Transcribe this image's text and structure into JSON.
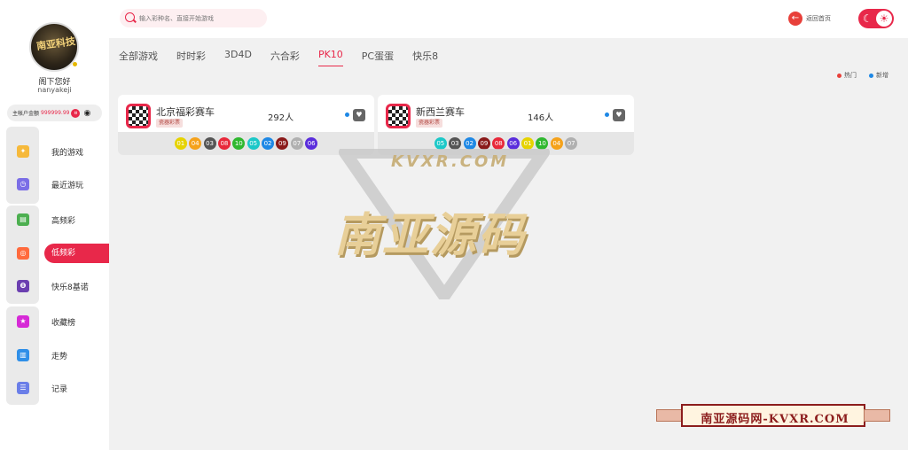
{
  "user": {
    "greeting": "阁下您好",
    "username": "nanyakeji",
    "avatar_text": "南亚科技",
    "balance_label": "主帐户金额",
    "balance_amount": "999999.99",
    "currency_icon": "coin-icon",
    "eye_icon": "eye-icon"
  },
  "menu": [
    {
      "label": "我的游戏",
      "icon": "game-icon",
      "color": "#f6b93b"
    },
    {
      "label": "最近游玩",
      "icon": "clock-icon",
      "color": "#7b6ee6"
    },
    {
      "label": "高频彩",
      "icon": "lottery-icon",
      "color": "#4caf50"
    },
    {
      "label": "低频彩",
      "icon": "lottery-icon",
      "color": "#ff6a3d"
    },
    {
      "label": "快乐8基诺",
      "icon": "keno-icon",
      "color": "#6b3fb0"
    },
    {
      "label": "收藏榜",
      "icon": "star-icon",
      "color": "#d62ad6"
    },
    {
      "label": "走势",
      "icon": "chart-icon",
      "color": "#2f8fe8"
    },
    {
      "label": "记录",
      "icon": "record-icon",
      "color": "#6a7ee8"
    }
  ],
  "search": {
    "placeholder": "输入彩种名、直接开始游戏"
  },
  "header": {
    "back_label": "返回首页"
  },
  "tabs": [
    "全部游戏",
    "时时彩",
    "3D4D",
    "六合彩",
    "PK10",
    "PC蛋蛋",
    "快乐8"
  ],
  "legend": {
    "hot": "热门",
    "new": "新增",
    "hot_color": "#e8403a",
    "new_color": "#1e88e5"
  },
  "games": [
    {
      "name": "北京福彩赛车",
      "tag": "瓷器彩票",
      "players": "292人",
      "balls": [
        "01",
        "04",
        "03",
        "08",
        "10",
        "05",
        "02",
        "09",
        "07",
        "06"
      ]
    },
    {
      "name": "新西兰赛车",
      "tag": "瓷器彩票",
      "players": "146人",
      "balls": [
        "05",
        "03",
        "02",
        "09",
        "08",
        "06",
        "01",
        "10",
        "04",
        "07"
      ]
    }
  ],
  "ball_colors": {
    "01": "#e6d300",
    "02": "#1e88e5",
    "03": "#555555",
    "04": "#f5a21b",
    "05": "#1cc8c8",
    "06": "#5a2ddc",
    "07": "#b0b0b0",
    "08": "#e8283a",
    "09": "#8a1a1a",
    "10": "#2fb82f"
  },
  "watermark": {
    "big": "南亚源码",
    "small": "KVXR.COM",
    "badge": "南亚源码网-KVXR.COM"
  }
}
